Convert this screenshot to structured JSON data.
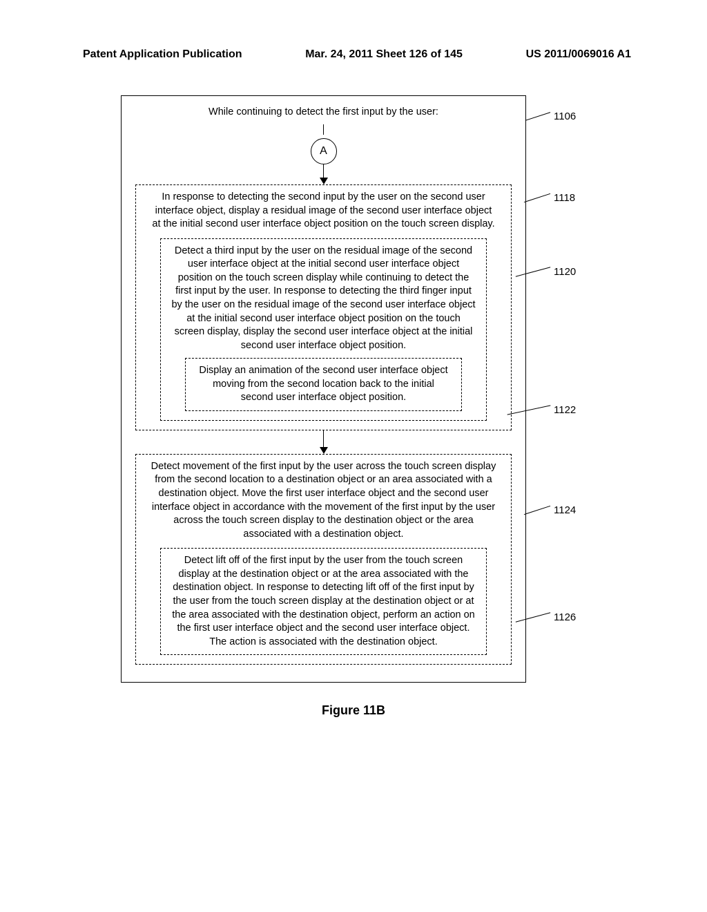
{
  "header": {
    "left": "Patent Application Publication",
    "center": "Mar. 24, 2011  Sheet 126 of 145",
    "right": "US 2011/0069016 A1"
  },
  "ref": {
    "n1106": "1106",
    "n1118": "1118",
    "n1120": "1120",
    "n1122": "1122",
    "n1124": "1124",
    "n1126": "1126"
  },
  "connector": "A",
  "box1106_heading": "While continuing to detect the first input by the user:",
  "box1118": "In response to detecting the second input by the user on the second user interface object, display a residual image of the second user interface object at the initial second user interface object position on the touch screen display.",
  "box1120": "Detect a third input by the user on the residual image of the second user interface object at the initial second user interface object position on the touch screen display while continuing to detect the first input by the user. In response to detecting the third finger input by the user on the residual image of the second user interface object at the initial second user interface object position on the touch screen display, display the second user interface object at the initial second user interface object position.",
  "box1122": "Display an animation of the second user interface object moving from the second location back to the initial second user interface object position.",
  "box1124": "Detect movement of the first input by the user across the touch screen display from the second location to a destination object or an area associated with a destination object. Move the first user interface object and the second user interface object in accordance with the movement of the first input by the user across the touch screen display to the destination object or the area associated with a destination object.",
  "box1126": "Detect lift off of the first input by the user from the touch screen display at the destination object or at the area associated with the destination object. In response to detecting lift off of the first input by the user from the touch screen display at the destination object or at the area associated with the destination object, perform an action on the first user interface object and the second user interface object. The action is associated with the destination object.",
  "figure": "Figure 11B"
}
